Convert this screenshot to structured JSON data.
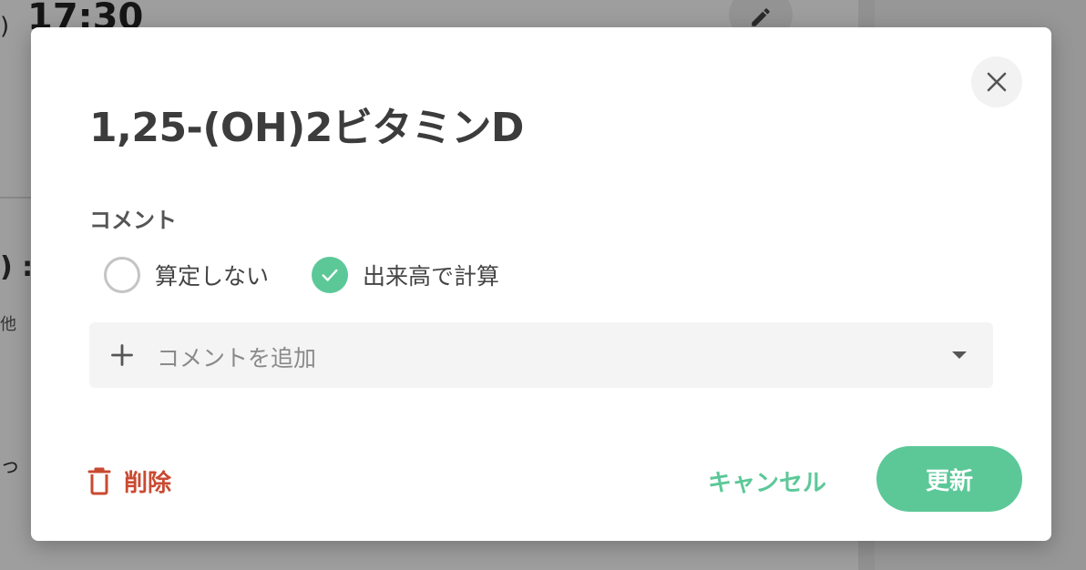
{
  "background": {
    "time": "17:30",
    "paren_top": ")",
    "paren_mid": ") :",
    "small_text": "他",
    "small_text2": "っ"
  },
  "dialog": {
    "title": "1,25-(OH)2ビタミンD",
    "section_label": "コメント",
    "options": [
      {
        "label": "算定しない",
        "selected": false
      },
      {
        "label": "出来高で計算",
        "selected": true
      }
    ],
    "comment_placeholder": "コメントを追加",
    "delete_label": "削除",
    "cancel_label": "キャンセル",
    "update_label": "更新"
  },
  "colors": {
    "accent": "#5cc898",
    "danger": "#c94a32",
    "title": "#3c3c3c"
  },
  "icons": {
    "close": "close-icon",
    "check": "check-icon",
    "plus": "plus-icon",
    "caret": "caret-down-icon",
    "trash": "trash-icon",
    "edit": "pencil-icon"
  }
}
